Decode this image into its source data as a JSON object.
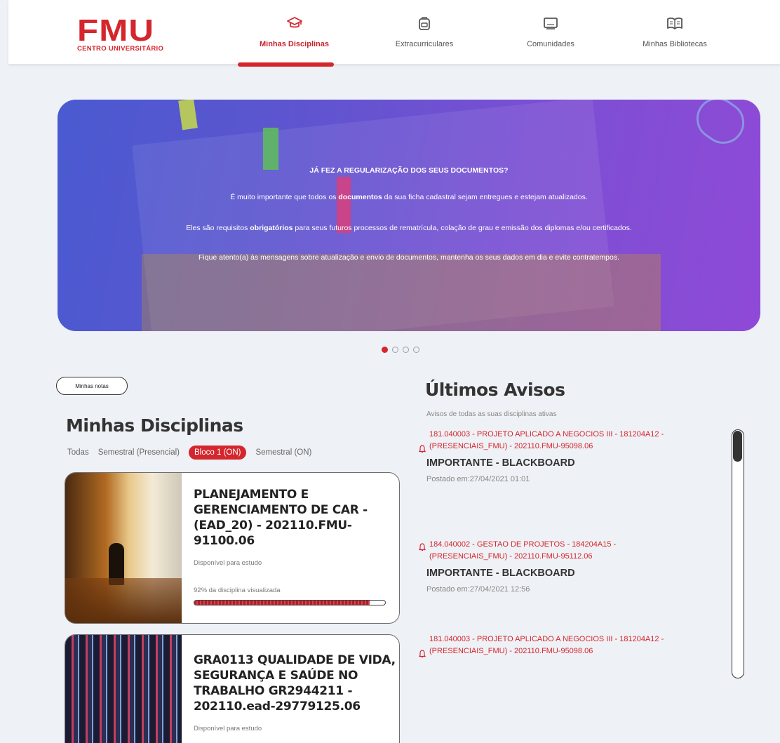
{
  "header": {
    "logo": {
      "main": "FMU",
      "sub": "CENTRO UNIVERSITÁRIO"
    },
    "nav": [
      {
        "label": "Minhas Disciplinas",
        "icon": "graduation-cap-icon",
        "active": true
      },
      {
        "label": "Extracurriculares",
        "icon": "backpack-icon",
        "active": false
      },
      {
        "label": "Comunidades",
        "icon": "chat-screen-icon",
        "active": false
      },
      {
        "label": "Minhas Bibliotecas",
        "icon": "book-icon",
        "active": false
      }
    ]
  },
  "banner": {
    "heading": "JÁ FEZ A REGULARIZAÇÃO DOS SEUS DOCUMENTOS?",
    "line1_a": "É muito importante que todos os ",
    "line1_b": "documentos",
    "line1_c": " da sua ficha cadastral sejam entregues e estejam atualizados.",
    "line2_a": "Eles são requisitos ",
    "line2_b": "obrigatórios",
    "line2_c": " para seus futuros processos de rematrícula, colação de grau e emissão dos diplomas e/ou certificados.",
    "line3": "Fique atento(a) às mensagens sobre atualização e envio de documentos, mantenha os seus dados em dia e evite contratempos.",
    "slides": 4,
    "active_slide": 1
  },
  "left": {
    "notes_button": "Minhas notas",
    "title": "Minhas Disciplinas",
    "filters": [
      "Todas",
      "Semestral (Presencial)",
      "Bloco 1 (ON)",
      "Semestral (ON)"
    ],
    "active_filter": "Bloco 1 (ON)",
    "cards": [
      {
        "title": "PLANEJAMENTO E GERENCIAMENTO DE CAR - (EAD_20) - 202110.FMU-91100.06",
        "status": "Disponível para estudo",
        "progress_label": "92% da disciplina visualizada",
        "progress": 0.92
      },
      {
        "title": "GRA0113 QUALIDADE DE VIDA, SEGURANÇA E SAÚDE NO TRABALHO GR2944211 - 202110.ead-29779125.06",
        "status": "Disponível para estudo"
      }
    ]
  },
  "right": {
    "title": "Últimos Avisos",
    "subtitle": "Avisos de todas as suas disciplinas ativas",
    "avisos": [
      {
        "head": "181.040003 - PROJETO APLICADO A NEGOCIOS III - 181204A12 - (PRESENCIAIS_FMU) - 202110.FMU-95098.06",
        "kind": "IMPORTANTE - BLACKBOARD",
        "posted": "Postado em:27/04/2021 01:01"
      },
      {
        "head": "184.040002 - GESTAO DE PROJETOS - 184204A15 - (PRESENCIAIS_FMU) - 202110.FMU-95112.06",
        "kind": "IMPORTANTE - BLACKBOARD",
        "posted": "Postado em:27/04/2021 12:56"
      },
      {
        "head": "181.040003 - PROJETO APLICADO A NEGOCIOS III - 181204A12 - (PRESENCIAIS_FMU) - 202110.FMU-95098.06"
      }
    ]
  },
  "colors": {
    "brand_red": "#d4262d",
    "background": "#eef1f5",
    "text": "#333333"
  }
}
